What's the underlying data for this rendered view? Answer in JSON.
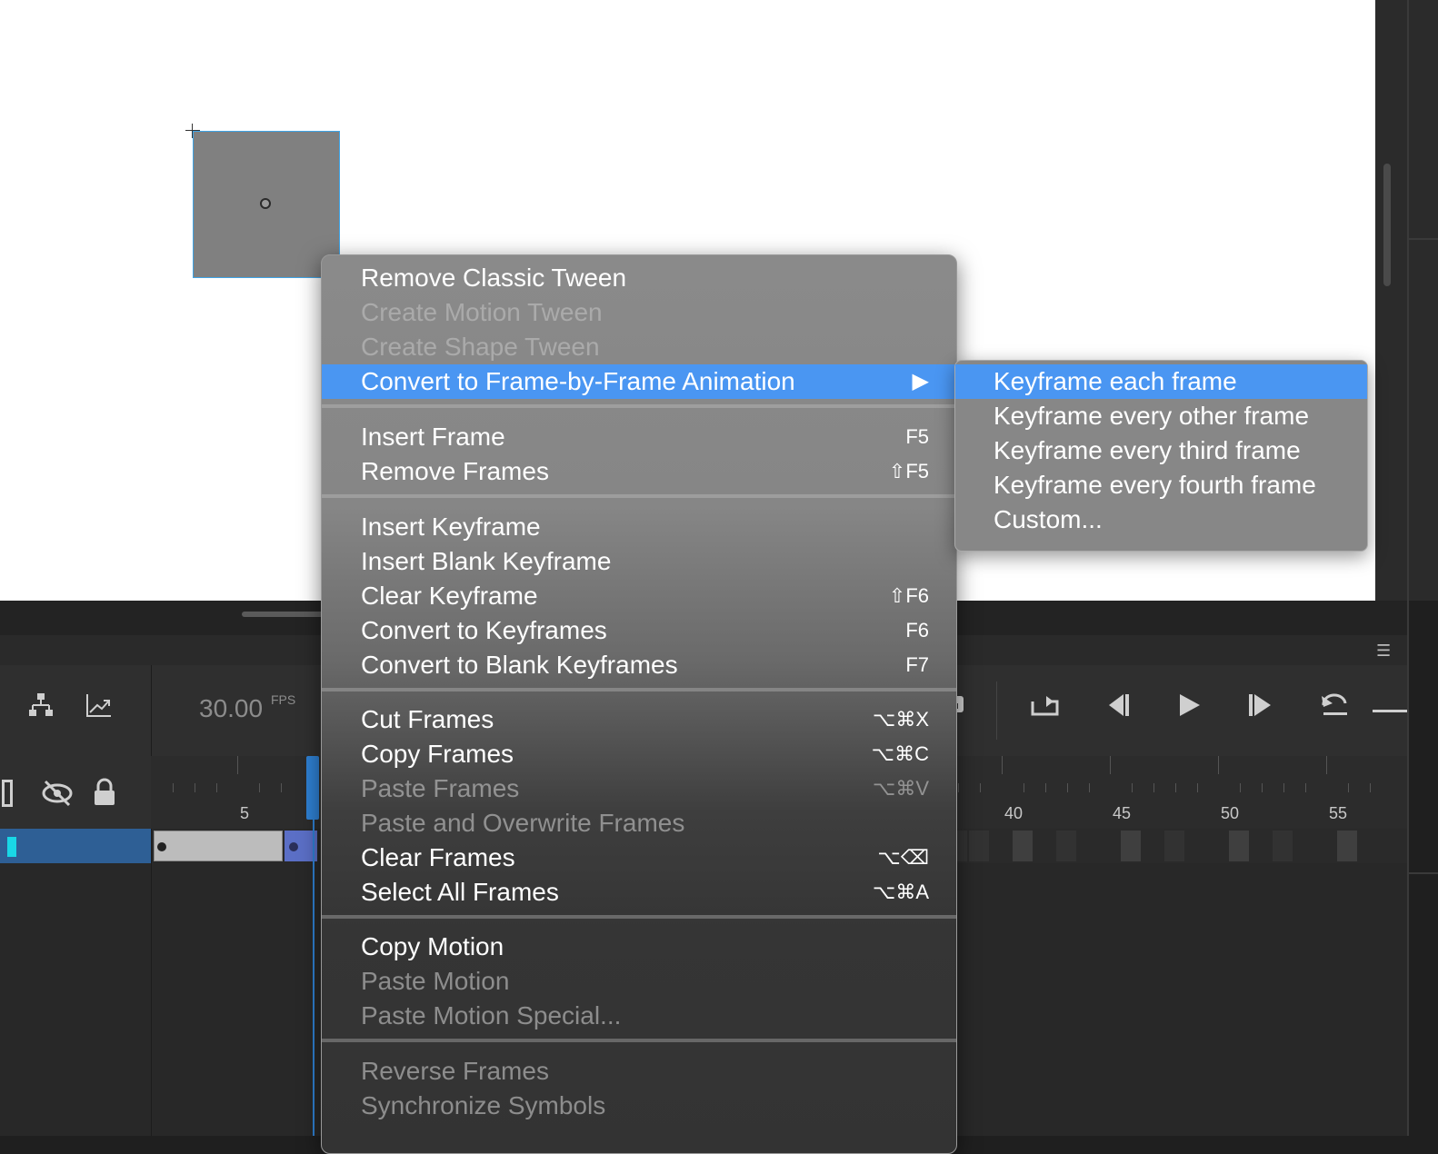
{
  "stage": {
    "background": "#ffffff"
  },
  "timeline": {
    "fps_value": "30.00",
    "fps_label": "FPS",
    "frame_numbers": [
      "5",
      "40",
      "45",
      "50",
      "55"
    ],
    "icons": [
      "parent-layer-icon",
      "graph-icon",
      "outline-icon",
      "eye-hidden-icon",
      "lock-icon",
      "camera-icon",
      "loop-icon",
      "step-back-icon",
      "play-icon",
      "step-forward-icon",
      "undo-loop-icon",
      "menu-icon"
    ]
  },
  "context_menu": {
    "items": [
      {
        "label": "Remove Classic Tween",
        "shortcut": "",
        "enabled": true
      },
      {
        "label": "Create Motion Tween",
        "shortcut": "",
        "enabled": false
      },
      {
        "label": "Create Shape Tween",
        "shortcut": "",
        "enabled": false
      },
      {
        "label": "Convert to Frame-by-Frame Animation",
        "shortcut": "▶",
        "enabled": true,
        "highlighted": true
      },
      {
        "label": "Insert Frame",
        "shortcut": "F5",
        "enabled": true
      },
      {
        "label": "Remove Frames",
        "shortcut": "⇧F5",
        "enabled": true
      },
      {
        "label": "Insert Keyframe",
        "shortcut": "",
        "enabled": true
      },
      {
        "label": "Insert Blank Keyframe",
        "shortcut": "",
        "enabled": true
      },
      {
        "label": "Clear Keyframe",
        "shortcut": "⇧F6",
        "enabled": true
      },
      {
        "label": "Convert to Keyframes",
        "shortcut": "F6",
        "enabled": true
      },
      {
        "label": "Convert to Blank Keyframes",
        "shortcut": "F7",
        "enabled": true
      },
      {
        "label": "Cut Frames",
        "shortcut": "⌥⌘X",
        "enabled": true
      },
      {
        "label": "Copy Frames",
        "shortcut": "⌥⌘C",
        "enabled": true
      },
      {
        "label": "Paste Frames",
        "shortcut": "⌥⌘V",
        "enabled": false
      },
      {
        "label": "Paste and Overwrite Frames",
        "shortcut": "",
        "enabled": false
      },
      {
        "label": "Clear Frames",
        "shortcut": "⌥⌫",
        "enabled": true
      },
      {
        "label": "Select All Frames",
        "shortcut": "⌥⌘A",
        "enabled": true
      },
      {
        "label": "Copy Motion",
        "shortcut": "",
        "enabled": true
      },
      {
        "label": "Paste Motion",
        "shortcut": "",
        "enabled": false
      },
      {
        "label": "Paste Motion Special...",
        "shortcut": "",
        "enabled": false
      },
      {
        "label": "Reverse Frames",
        "shortcut": "",
        "enabled": false
      },
      {
        "label": "Synchronize Symbols",
        "shortcut": "",
        "enabled": false
      }
    ]
  },
  "submenu": {
    "items": [
      {
        "label": "Keyframe each frame",
        "highlighted": true
      },
      {
        "label": "Keyframe every other frame"
      },
      {
        "label": "Keyframe every third frame"
      },
      {
        "label": "Keyframe every fourth frame"
      },
      {
        "label": "Custom..."
      }
    ]
  },
  "colors": {
    "highlight": "#4a96f2",
    "playhead": "#2e7fd1",
    "layer": "#2e5f95",
    "layer_marker": "#19d7e6"
  }
}
